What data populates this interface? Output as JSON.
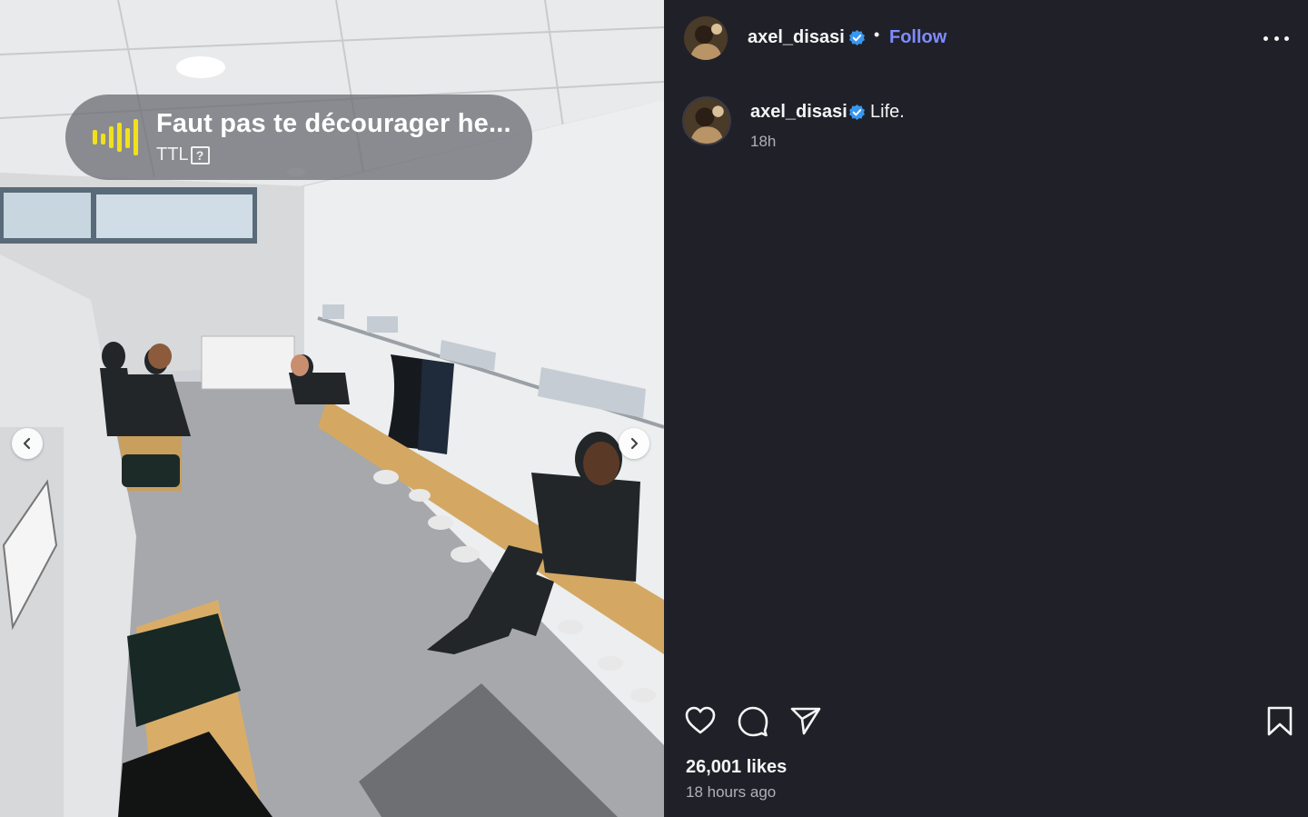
{
  "media": {
    "audio_title": "Faut pas te décourager he...",
    "audio_artist": "TTL",
    "audio_unknown_badge": "?",
    "scene_description_icon": "photo-locker-room",
    "prev_icon": "chevron-left-icon",
    "next_icon": "chevron-right-icon"
  },
  "header": {
    "username": "axel_disasi",
    "separator": "•",
    "follow_label": "Follow",
    "more_icon": "more-horizontal-icon"
  },
  "caption": {
    "username": "axel_disasi",
    "text": "Life.",
    "time": "18h"
  },
  "actions": {
    "like_icon": "heart-icon",
    "comment_icon": "comment-icon",
    "share_icon": "send-icon",
    "save_icon": "bookmark-icon"
  },
  "stats": {
    "likes": "26,001 likes",
    "posted": "18 hours ago"
  },
  "colors": {
    "background": "#202029",
    "follow": "#7f8cff",
    "verified": "#3897f0",
    "audio_bars": "#f2e01a"
  }
}
